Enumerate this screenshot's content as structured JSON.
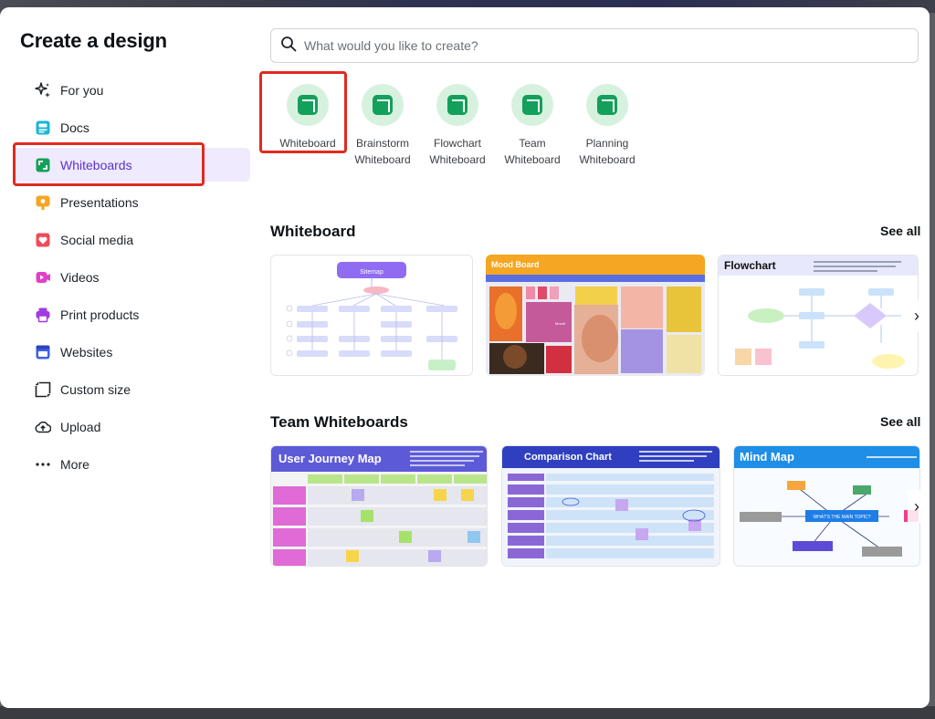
{
  "modal": {
    "title": "Create a design"
  },
  "sidebar": {
    "items": [
      {
        "label": "For you",
        "icon": "sparkle-icon"
      },
      {
        "label": "Docs",
        "icon": "docs-icon"
      },
      {
        "label": "Whiteboards",
        "icon": "whiteboard-icon",
        "active": true
      },
      {
        "label": "Presentations",
        "icon": "presentation-icon"
      },
      {
        "label": "Social media",
        "icon": "heart-icon"
      },
      {
        "label": "Videos",
        "icon": "video-icon"
      },
      {
        "label": "Print products",
        "icon": "printer-icon"
      },
      {
        "label": "Websites",
        "icon": "website-icon"
      },
      {
        "label": "Custom size",
        "icon": "custom-size-icon"
      },
      {
        "label": "Upload",
        "icon": "upload-icon"
      },
      {
        "label": "More",
        "icon": "more-dots-icon"
      }
    ]
  },
  "search": {
    "placeholder": "What would you like to create?"
  },
  "quick_types": [
    {
      "line1": "Whiteboard",
      "line2": ""
    },
    {
      "line1": "Brainstorm",
      "line2": "Whiteboard"
    },
    {
      "line1": "Flowchart",
      "line2": "Whiteboard"
    },
    {
      "line1": "Team",
      "line2": "Whiteboard"
    },
    {
      "line1": "Planning",
      "line2": "Whiteboard"
    }
  ],
  "sections": [
    {
      "title": "Whiteboard",
      "see_all": "See all",
      "cards": [
        {
          "heading": "Sitemap"
        },
        {
          "heading": "Mood Board",
          "sub": "Moodi"
        },
        {
          "heading": "Flowchart"
        }
      ]
    },
    {
      "title": "Team Whiteboards",
      "see_all": "See all",
      "cards": [
        {
          "heading": "User Journey Map"
        },
        {
          "heading": "Comparison Chart"
        },
        {
          "heading": "Mind Map",
          "center": "WHAT'S THE MAIN TOPIC?"
        }
      ]
    }
  ],
  "colors": {
    "accent": "#5a32c8",
    "active_bg": "#efeafd",
    "whiteboard_green": "#13a05a",
    "highlight_red": "#e02a1f"
  }
}
